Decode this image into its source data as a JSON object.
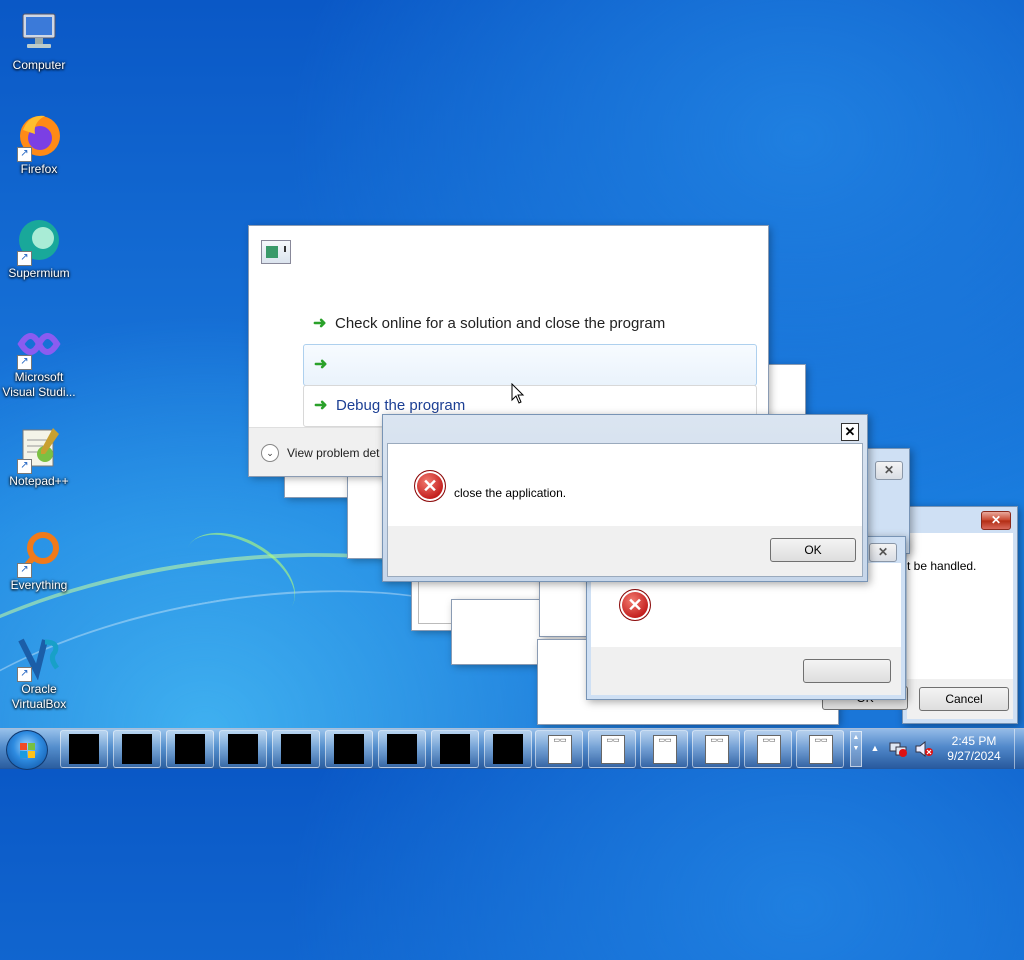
{
  "desktop": {
    "icons": [
      {
        "label": "Computer",
        "icon": "computer-icon"
      },
      {
        "label": "Firefox",
        "icon": "firefox-icon"
      },
      {
        "label": "Supermium",
        "icon": "supermium-icon"
      },
      {
        "label": "Microsoft Visual Studi...",
        "icon": "visual-studio-icon"
      },
      {
        "label": "Notepad++",
        "icon": "notepadpp-icon"
      },
      {
        "label": "Everything",
        "icon": "everything-icon"
      },
      {
        "label": "Oracle VirtualBox",
        "icon": "virtualbox-icon"
      }
    ]
  },
  "wer_dialog": {
    "options": [
      {
        "label": "Check online for a solution and close the program"
      },
      {
        "label": ""
      },
      {
        "label": "Debug the program"
      }
    ],
    "details_label": "View problem det"
  },
  "error_dialog": {
    "message": "close the application.",
    "ok_label": "OK",
    "close_glyph": "✕"
  },
  "right_dialog": {
    "message": "t be handled.",
    "ok_label": "OK",
    "cancel_label": "Cancel"
  },
  "taskbar": {
    "black_windows_count": 9,
    "app_windows_count": 6,
    "clock_time": "2:45 PM",
    "clock_date": "9/27/2024",
    "tray_chevron": "▲"
  },
  "colors": {
    "link_blue": "#1c3f94",
    "arrow_green": "#2aa12a",
    "error_red": "#c01818"
  }
}
